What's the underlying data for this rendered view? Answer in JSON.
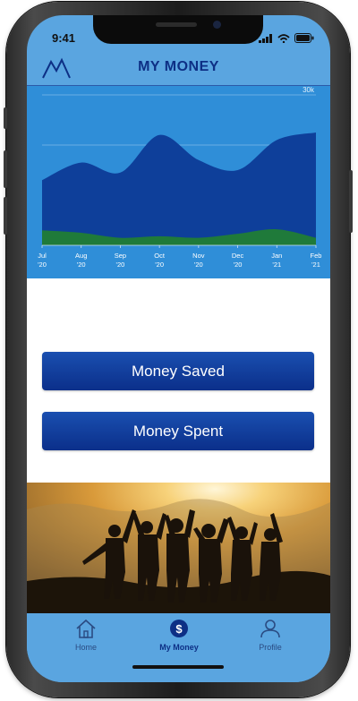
{
  "status_bar": {
    "time": "9:41"
  },
  "header": {
    "title": "MY MONEY",
    "logo_icon": "mountain-logo-icon"
  },
  "chart_data": {
    "type": "area",
    "x": [
      "Jul '20",
      "Aug '20",
      "Sep '20",
      "Oct '20",
      "Nov '20",
      "Dec '20",
      "Jan '21",
      "Feb '21"
    ],
    "y_ticks": [
      "10k",
      "20k",
      "30k"
    ],
    "ylim": [
      0,
      30000
    ],
    "series": [
      {
        "values": [
          13000,
          16500,
          14500,
          22000,
          17000,
          15000,
          21000,
          22500
        ]
      },
      {
        "values": [
          3000,
          2500,
          1500,
          1800,
          1500,
          2300,
          3200,
          1500
        ]
      }
    ],
    "colors": {
      "upper": "#0e3f9a",
      "lower": "#1f7a3a",
      "background": "#2f8ed8"
    }
  },
  "buttons": {
    "money_saved": "Money Saved",
    "money_spent": "Money Spent"
  },
  "tabs": [
    {
      "label": "Home",
      "icon": "home-icon"
    },
    {
      "label": "My Money",
      "icon": "dollar-icon"
    },
    {
      "label": "Profile",
      "icon": "user-icon"
    }
  ]
}
